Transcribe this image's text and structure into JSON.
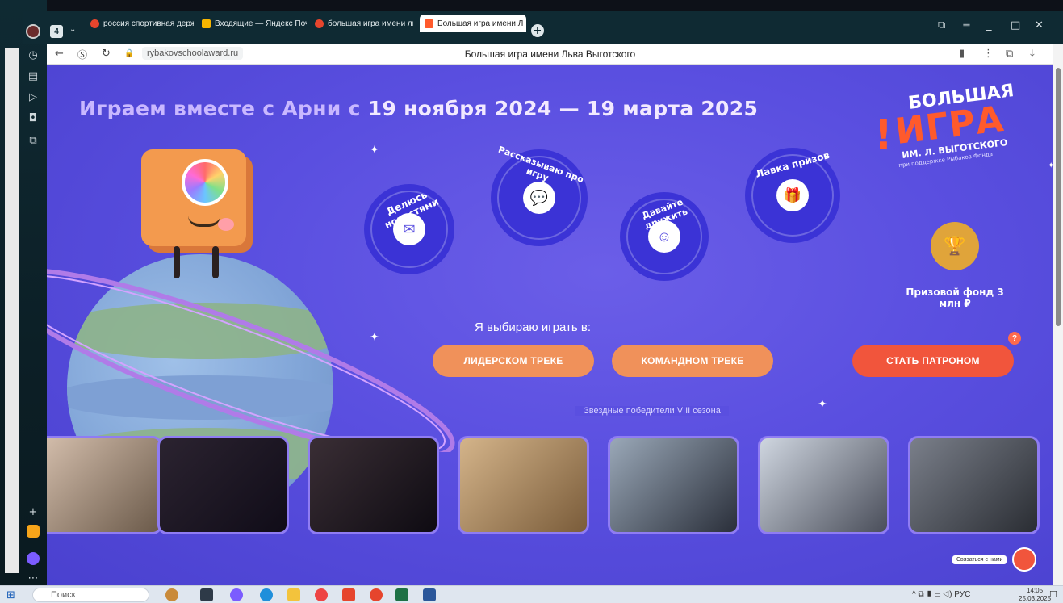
{
  "browser": {
    "tabs": [
      {
        "label": "россия спортивная держ",
        "fav_color": "#e6452d"
      },
      {
        "label": "Входящие — Яндекс Почт",
        "fav_color": "#f7b500"
      },
      {
        "label": "большая игра имени льв",
        "fav_color": "#e6452d"
      },
      {
        "label": "Большая игра имени Л",
        "fav_color": "#ff5a2c",
        "active": true
      }
    ],
    "tab_count": "4",
    "url": "rybakovschoolaward.ru",
    "page_title": "Большая игра имени Льва Выготского"
  },
  "page": {
    "headline_prefix": "Играем вместе с Арни с ",
    "headline_dates": "19 ноября 2024 — 19 марта 2025",
    "logo": {
      "line1": "БОЛЬШАЯ",
      "line2": "ИГРА",
      "line3": "ИМ. Л. ВЫГОТСКОГО",
      "line4": "при поддержке Рыбаков Фонда"
    },
    "badges": [
      {
        "label": "Делюсь новостями",
        "icon": "envelope-icon"
      },
      {
        "label": "Рассказываю про игру",
        "icon": "speech-bubble-icon"
      },
      {
        "label": "Давайте дружить",
        "icon": "people-icon"
      },
      {
        "label": "Лавка призов",
        "icon": "gift-icon"
      }
    ],
    "prize_fund": "Призовой фонд 3 млн ₽",
    "choose_label": "Я выбираю играть в:",
    "buttons": {
      "leader": "ЛИДЕРСКОМ ТРЕКЕ",
      "team": "КОМАНДНОМ ТРЕКЕ",
      "patron": "СТАТЬ ПАТРОНОМ"
    },
    "help": "?",
    "winners_label": "Звездные победители VIII сезона",
    "contact_label": "Связаться с нами"
  },
  "taskbar": {
    "search_placeholder": "Поиск",
    "lang": "РУС",
    "time": "14:05",
    "date": "25.03.2025"
  },
  "colors": {
    "page_bg": "#5a4fe0",
    "accent_orange": "#f0915a",
    "accent_red": "#f1553c",
    "badge_bg": "#3b33d6"
  }
}
